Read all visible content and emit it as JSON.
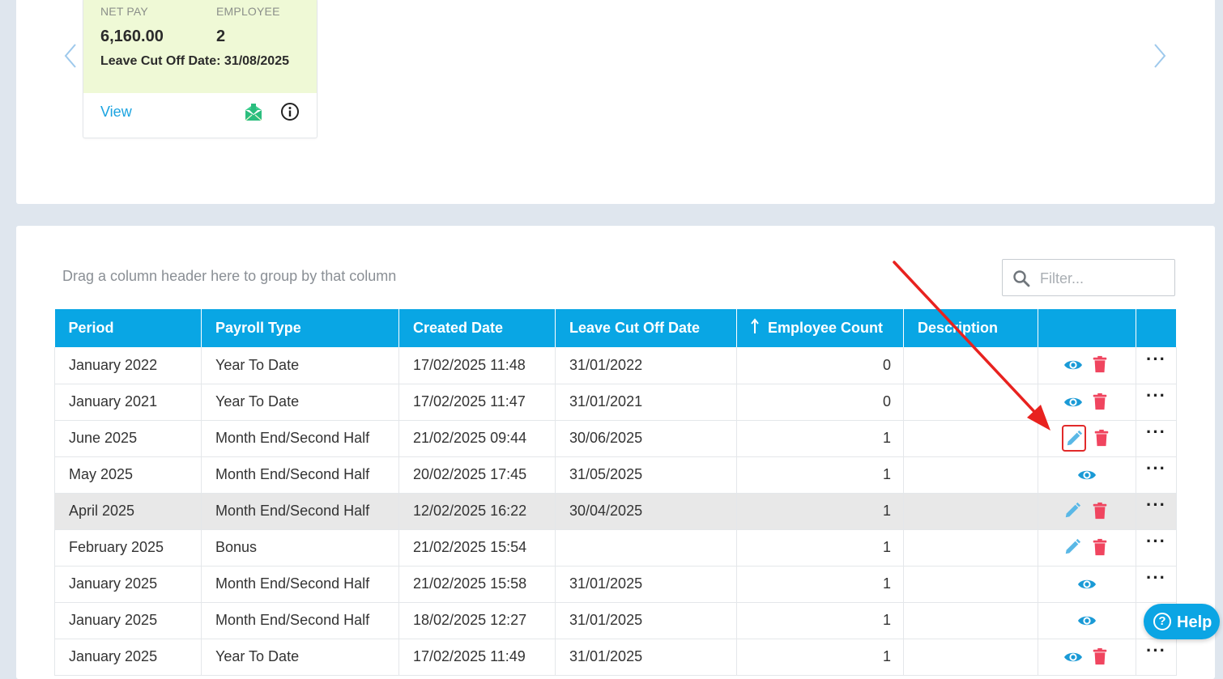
{
  "summary_card": {
    "net_pay_label": "NET PAY",
    "net_pay_value": "6,160.00",
    "employee_label": "EMPLOYEE",
    "employee_value": "2",
    "leave_cut_off_line": "Leave Cut Off Date: 31/08/2025",
    "view_link": "View",
    "payslip_icon": "envelope-download-icon",
    "info_icon": "info-icon",
    "background_color": "#eff9d6"
  },
  "grid": {
    "group_hint": "Drag a column header here to group by that column",
    "filter_placeholder": "Filter...",
    "header_color": "#09a6e4",
    "columns": [
      "Period",
      "Payroll Type",
      "Created Date",
      "Leave Cut Off Date",
      "Employee Count",
      "Description",
      "",
      ""
    ],
    "sorted_column": "Employee Count",
    "sort_direction": "ascending",
    "rows": [
      {
        "period": "January 2022",
        "payroll_type": "Year To Date",
        "created_date": "17/02/2025 11:48",
        "leave_cut_off": "31/01/2022",
        "employee_count": "0",
        "description": "",
        "actions": [
          "view",
          "delete"
        ]
      },
      {
        "period": "January 2021",
        "payroll_type": "Year To Date",
        "created_date": "17/02/2025 11:47",
        "leave_cut_off": "31/01/2021",
        "employee_count": "0",
        "description": "",
        "actions": [
          "view",
          "delete"
        ]
      },
      {
        "period": "June 2025",
        "payroll_type": "Month End/Second Half",
        "created_date": "21/02/2025 09:44",
        "leave_cut_off": "30/06/2025",
        "employee_count": "1",
        "description": "",
        "actions": [
          "edit",
          "delete"
        ]
      },
      {
        "period": "May 2025",
        "payroll_type": "Month End/Second Half",
        "created_date": "20/02/2025 17:45",
        "leave_cut_off": "31/05/2025",
        "employee_count": "1",
        "description": "",
        "actions": [
          "view"
        ]
      },
      {
        "period": "April 2025",
        "payroll_type": "Month End/Second Half",
        "created_date": "12/02/2025 16:22",
        "leave_cut_off": "30/04/2025",
        "employee_count": "1",
        "description": "",
        "actions": [
          "edit",
          "delete"
        ]
      },
      {
        "period": "February 2025",
        "payroll_type": "Bonus",
        "created_date": "21/02/2025 15:54",
        "leave_cut_off": "",
        "employee_count": "1",
        "description": "",
        "actions": [
          "edit",
          "delete"
        ]
      },
      {
        "period": "January 2025",
        "payroll_type": "Month End/Second Half",
        "created_date": "21/02/2025 15:58",
        "leave_cut_off": "31/01/2025",
        "employee_count": "1",
        "description": "",
        "actions": [
          "view"
        ]
      },
      {
        "period": "January 2025",
        "payroll_type": "Month End/Second Half",
        "created_date": "18/02/2025 12:27",
        "leave_cut_off": "31/01/2025",
        "employee_count": "1",
        "description": "",
        "actions": [
          "view"
        ]
      },
      {
        "period": "January 2025",
        "payroll_type": "Year To Date",
        "created_date": "17/02/2025 11:49",
        "leave_cut_off": "31/01/2025",
        "employee_count": "1",
        "description": "",
        "actions": [
          "view",
          "delete"
        ]
      }
    ],
    "highlighted_row_index": 4,
    "annotated_edit_row_index": 2,
    "more_label": "···",
    "icon_colors": {
      "view": "#1a9ad6",
      "edit": "#5ab8e6",
      "delete": "#f0455f",
      "annotation": "#e12a2a"
    }
  },
  "help_button": {
    "label": "Help",
    "icon": "?"
  }
}
